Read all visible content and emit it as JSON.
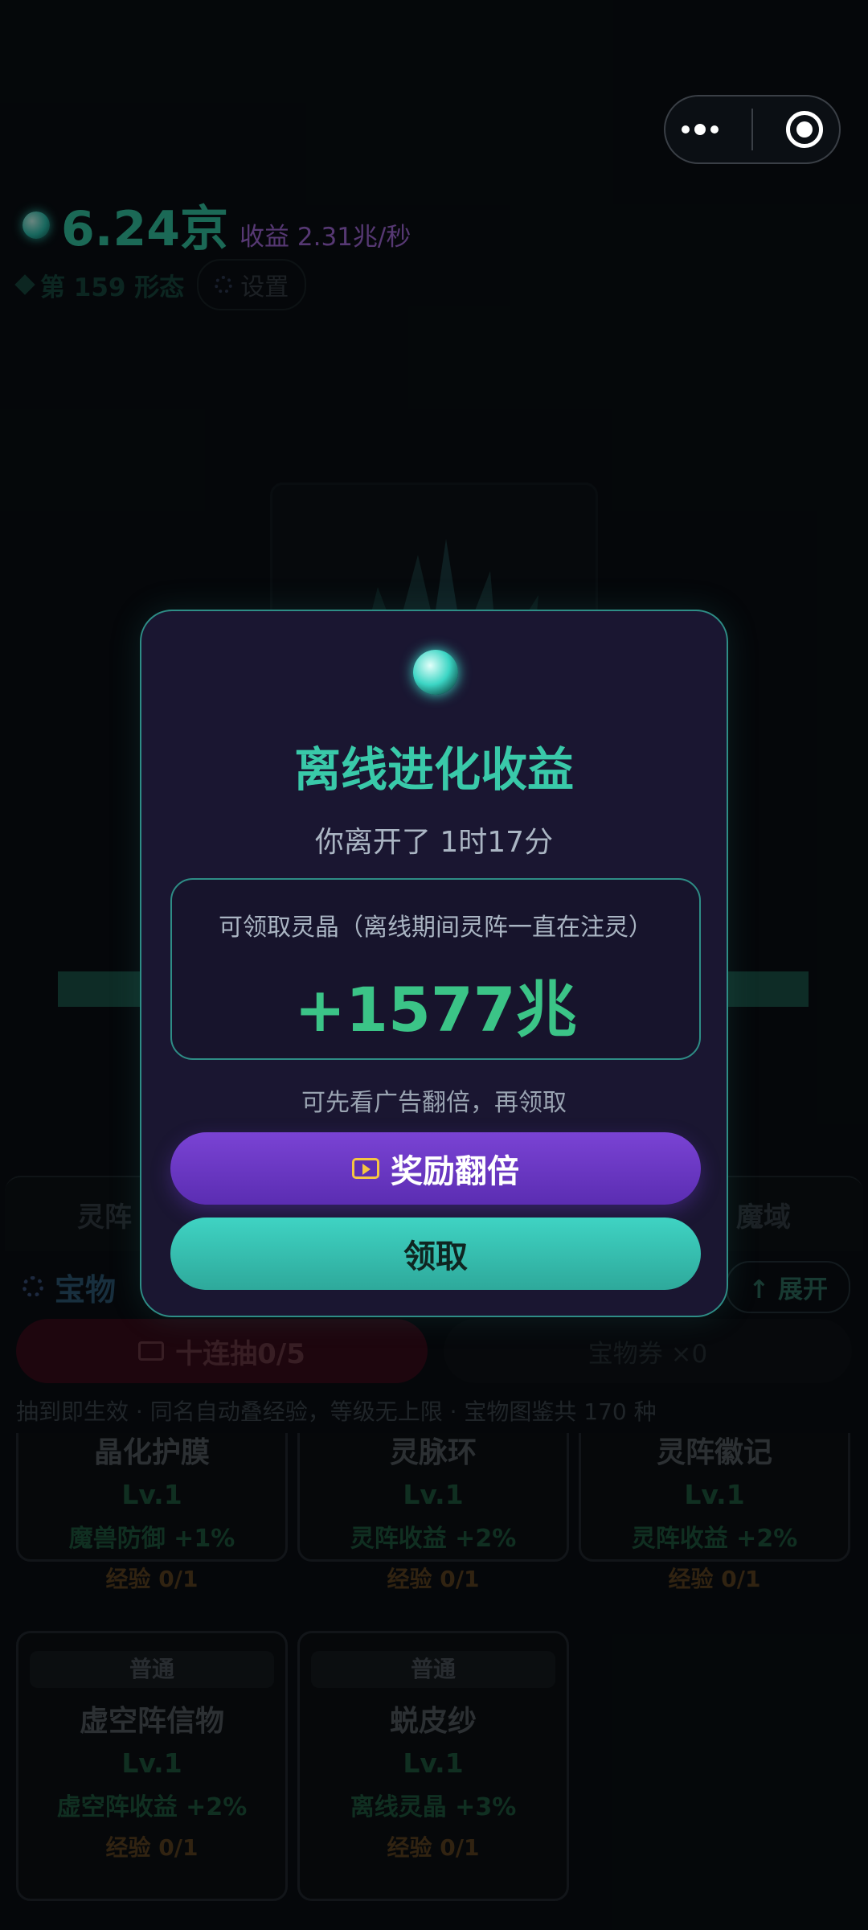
{
  "header": {
    "balance": "6.24京",
    "income": "收益 2.31兆/秒",
    "stage": "第 159 形态",
    "settings_label": "设置"
  },
  "tabs": [
    "灵阵",
    "魔域"
  ],
  "section": {
    "title": "宝物",
    "expand_label": "↑ 展开"
  },
  "pull": {
    "ten_pull_label": "十连抽0/5",
    "ticket_label": "宝物券 ×0",
    "hint": "抽到即生效 · 同名自动叠经验，等级无上限 · 宝物图鉴共 170 种"
  },
  "treasures": [
    {
      "rarity": "",
      "name": "晶化护膜",
      "level": "Lv.1",
      "effect": "魔兽防御 +1%",
      "exp": "经验 0/1"
    },
    {
      "rarity": "",
      "name": "灵脉环",
      "level": "Lv.1",
      "effect": "灵阵收益 +2%",
      "exp": "经验 0/1"
    },
    {
      "rarity": "",
      "name": "灵阵徽记",
      "level": "Lv.1",
      "effect": "灵阵收益 +2%",
      "exp": "经验 0/1"
    },
    {
      "rarity": "普通",
      "name": "虚空阵信物",
      "level": "Lv.1",
      "effect": "虚空阵收益 +2%",
      "exp": "经验 0/1"
    },
    {
      "rarity": "普通",
      "name": "蜕皮纱",
      "level": "Lv.1",
      "effect": "离线灵晶 +3%",
      "exp": "经验 0/1"
    }
  ],
  "modal": {
    "title": "离线进化收益",
    "away_text": "你离开了 1时17分",
    "reward_label": "可领取灵晶（离线期间灵阵一直在注灵）",
    "reward_amount": "+1577兆",
    "ad_hint": "可先看广告翻倍，再领取",
    "double_button": "奖励翻倍",
    "claim_button": "领取"
  },
  "colors": {
    "accent_teal": "#39c9a9",
    "accent_purple": "#7a43d4",
    "reward_green": "#3bc487"
  },
  "icons": [
    "more-dots-icon",
    "target-close-icon",
    "crystal-orb-icon",
    "settings-icon",
    "play-video-icon"
  ]
}
